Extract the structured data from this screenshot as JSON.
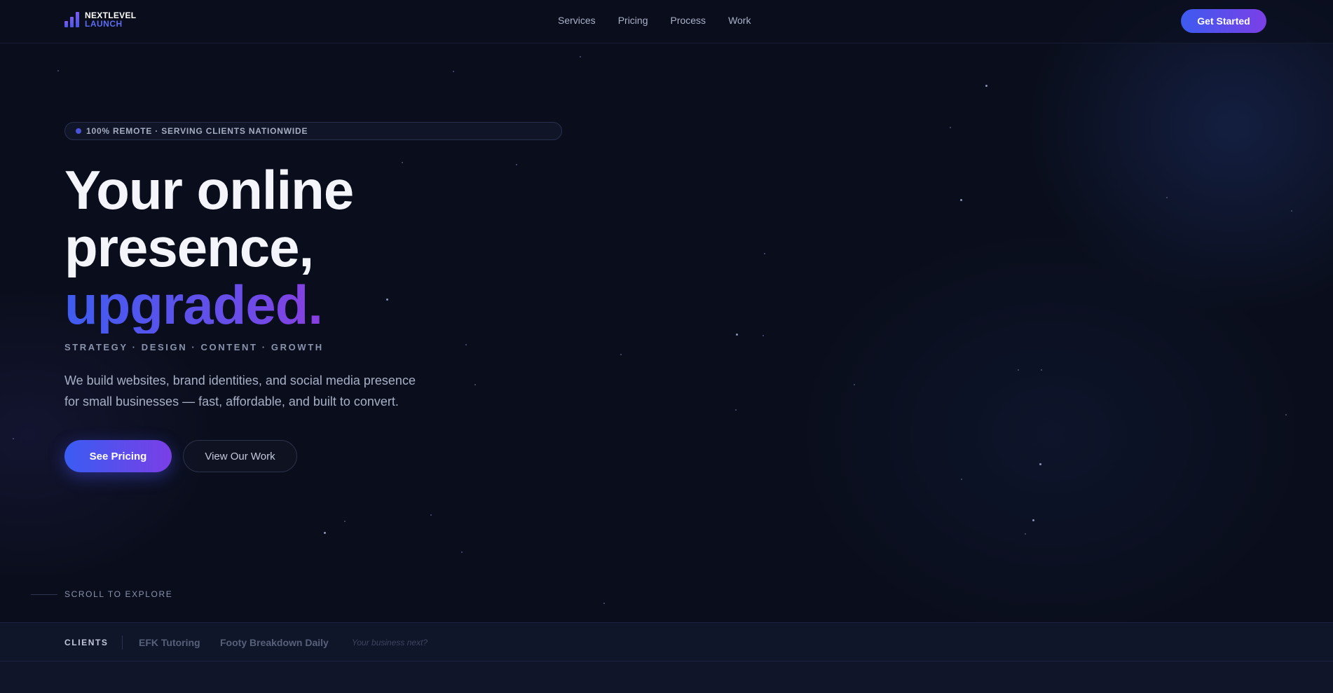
{
  "brand": {
    "name": "NEXTLEVEL",
    "sub": "LAUNCH",
    "colors": {
      "accent_start": "#3d5bf0",
      "accent_end": "#7b3fe6",
      "background": "#0a0e1c"
    }
  },
  "nav": {
    "items": [
      {
        "label": "Services"
      },
      {
        "label": "Pricing"
      },
      {
        "label": "Process"
      },
      {
        "label": "Work"
      }
    ],
    "cta_label": "Get Started"
  },
  "hero": {
    "badge": "100% REMOTE · SERVING CLIENTS NATIONWIDE",
    "headline_line1": "Your online",
    "headline_line2": "presence,",
    "headline_accent": "upgraded.",
    "tagline": "STRATEGY · DESIGN · CONTENT · GROWTH",
    "description": "We build websites, brand identities, and social media presence for small businesses — fast, affordable, and built to convert.",
    "primary_button": "See Pricing",
    "secondary_button": "View Our Work",
    "scroll_hint": "SCROLL TO EXPLORE"
  },
  "clients": {
    "label": "CLIENTS",
    "items": [
      {
        "name": "EFK Tutoring"
      },
      {
        "name": "Footy Breakdown Daily"
      }
    ],
    "next": "Your business next?"
  },
  "icons": {
    "logo": "bar-chart-icon",
    "badge_dot": "status-dot-icon"
  }
}
